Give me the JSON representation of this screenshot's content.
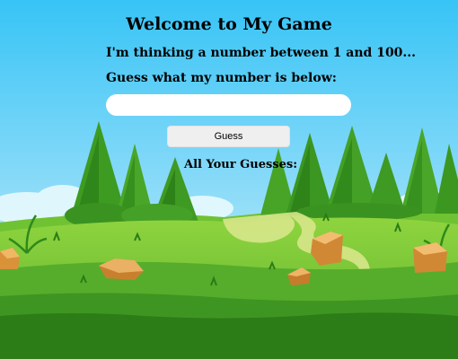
{
  "header": {
    "title": "Welcome to My Game"
  },
  "game": {
    "intro": "I'm thinking a number between 1 and 100...",
    "prompt": "Guess what my number is below:",
    "input_value": "",
    "input_placeholder": "",
    "guess_button_label": "Guess",
    "guesses_heading": "All Your Guesses:"
  },
  "colors": {
    "sky_top": "#3cc7f7",
    "sky_bottom": "#bfeefc",
    "grass_light": "#7fcf3a",
    "grass_dark": "#2f8a1a",
    "tree": "#3f9a23",
    "rock": "#d9913a"
  }
}
